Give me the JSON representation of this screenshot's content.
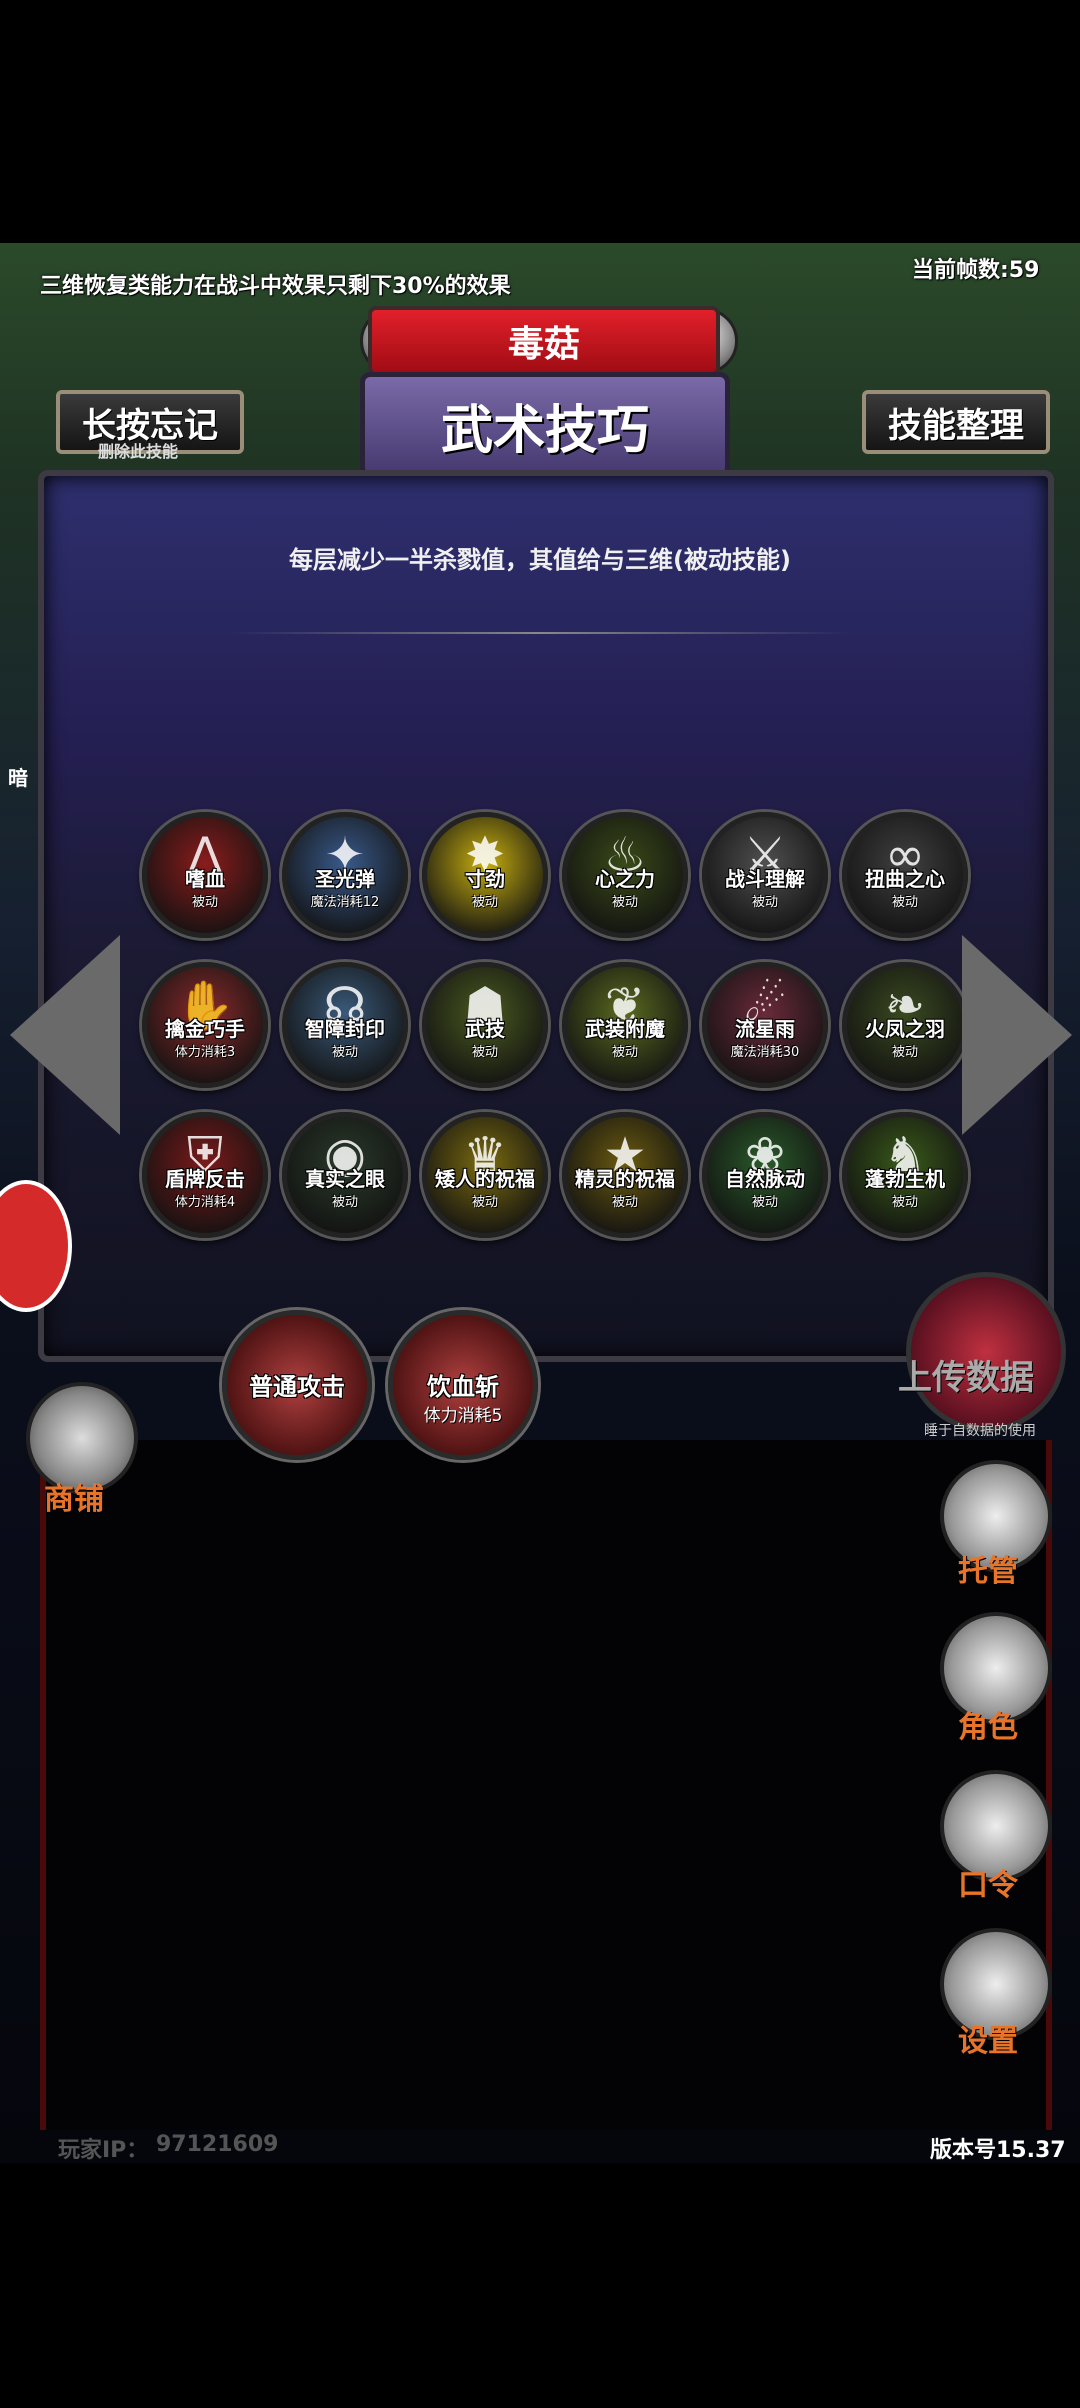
{
  "header": {
    "notice": "三维恢复类能力在战斗中效果只剩下30%的效果",
    "fps": "当前帧数:59"
  },
  "title": {
    "enemy_name": "毒菇",
    "category": "武术技巧"
  },
  "buttons": {
    "forget_label": "长按忘记",
    "forget_sub": "删除此技能",
    "arrange_label": "技能整理",
    "upload_label": "上传数据",
    "upload_sub": "睡于自数据的使用"
  },
  "description": "每层减少一半杀戮值，其值给与三维(被动技能)",
  "side_hint": "暗",
  "skills": [
    {
      "name": "嗜血",
      "cost": "被动",
      "color": "#8a1c1c",
      "icon": "claw-icon",
      "glyph": "⋀"
    },
    {
      "name": "圣光弹",
      "cost": "魔法消耗12",
      "color": "#3a5a8a",
      "icon": "holy-light-icon",
      "glyph": "✦"
    },
    {
      "name": "寸劲",
      "cost": "被动",
      "color": "#c8b010",
      "icon": "burst-icon",
      "glyph": "✸"
    },
    {
      "name": "心之力",
      "cost": "被动",
      "color": "#3a4a18",
      "icon": "flame-icon",
      "glyph": "♨"
    },
    {
      "name": "战斗理解",
      "cost": "被动",
      "color": "#505050",
      "icon": "crossed-swords-icon",
      "glyph": "⚔"
    },
    {
      "name": "扭曲之心",
      "cost": "被动",
      "color": "#404040",
      "icon": "twist-icon",
      "glyph": "∞"
    },
    {
      "name": "擒金巧手",
      "cost": "体力消耗3",
      "color": "#8a2a2a",
      "icon": "hand-icon",
      "glyph": "✋"
    },
    {
      "name": "智障封印",
      "cost": "被动",
      "color": "#3a5a7a",
      "icon": "seal-icon",
      "glyph": "☊"
    },
    {
      "name": "武技",
      "cost": "被动",
      "color": "#4a5a20",
      "icon": "fighter-icon",
      "glyph": "☗"
    },
    {
      "name": "武装附魔",
      "cost": "被动",
      "color": "#5a6a20",
      "icon": "wings-icon",
      "glyph": "❦"
    },
    {
      "name": "流星雨",
      "cost": "魔法消耗30",
      "color": "#6a2a3a",
      "icon": "meteor-icon",
      "glyph": "☄"
    },
    {
      "name": "火凤之羽",
      "cost": "被动",
      "color": "#3a4a20",
      "icon": "feather-icon",
      "glyph": "❧"
    },
    {
      "name": "盾牌反击",
      "cost": "体力消耗4",
      "color": "#7a1a1a",
      "icon": "shield-icon",
      "glyph": "⛨"
    },
    {
      "name": "真实之眼",
      "cost": "被动",
      "color": "#2a3a2a",
      "icon": "eye-icon",
      "glyph": "◉"
    },
    {
      "name": "矮人的祝福",
      "cost": "被动",
      "color": "#7a6a10",
      "icon": "helmet-icon",
      "glyph": "♛"
    },
    {
      "name": "精灵的祝福",
      "cost": "被动",
      "color": "#6a5a10",
      "icon": "star-icon",
      "glyph": "★"
    },
    {
      "name": "自然脉动",
      "cost": "被动",
      "color": "#2a5a2a",
      "icon": "leaf-icon",
      "glyph": "❀"
    },
    {
      "name": "蓬勃生机",
      "cost": "被动",
      "color": "#3a5a1a",
      "icon": "muscle-icon",
      "glyph": "♞"
    }
  ],
  "actions": [
    {
      "name": "普通攻击",
      "cost": ""
    },
    {
      "name": "饮血斩",
      "cost": "体力消耗5"
    }
  ],
  "menu": {
    "shop": "商铺",
    "auto": "托管",
    "character": "角色",
    "password": "口令",
    "settings": "设置"
  },
  "footer": {
    "player_ip_label": "玩家IP：",
    "player_ip": "97121609",
    "version": "版本号15.37"
  }
}
